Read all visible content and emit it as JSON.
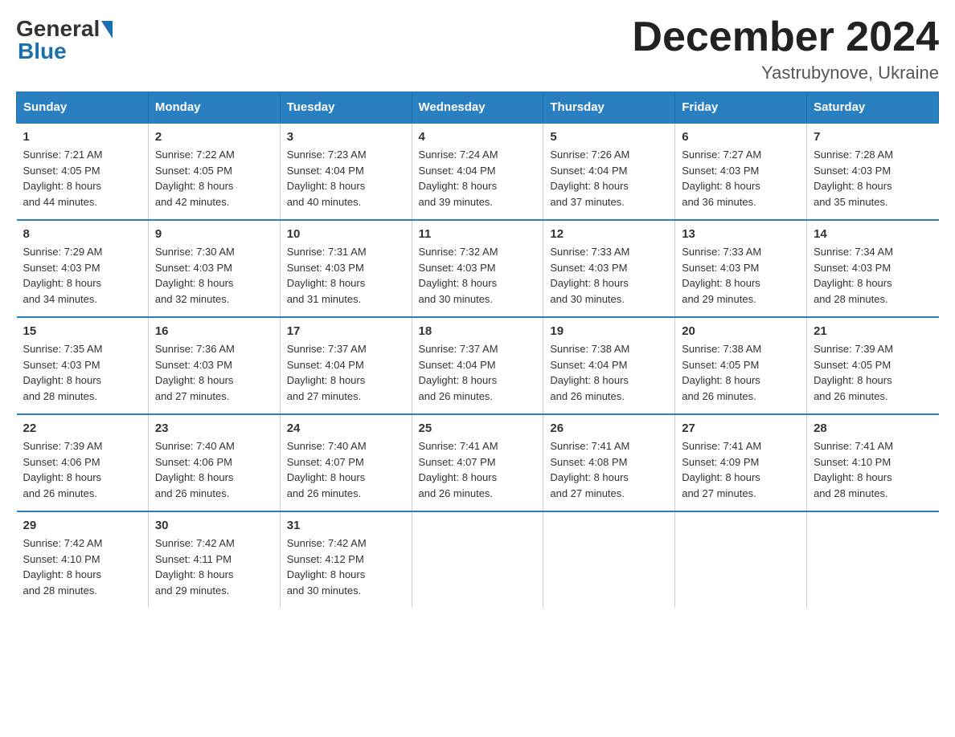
{
  "logo": {
    "general": "General",
    "blue": "Blue"
  },
  "header": {
    "month": "December 2024",
    "location": "Yastrubynove, Ukraine"
  },
  "days_of_week": [
    "Sunday",
    "Monday",
    "Tuesday",
    "Wednesday",
    "Thursday",
    "Friday",
    "Saturday"
  ],
  "weeks": [
    [
      {
        "day": "1",
        "sunrise": "7:21 AM",
        "sunset": "4:05 PM",
        "daylight": "8 hours and 44 minutes."
      },
      {
        "day": "2",
        "sunrise": "7:22 AM",
        "sunset": "4:05 PM",
        "daylight": "8 hours and 42 minutes."
      },
      {
        "day": "3",
        "sunrise": "7:23 AM",
        "sunset": "4:04 PM",
        "daylight": "8 hours and 40 minutes."
      },
      {
        "day": "4",
        "sunrise": "7:24 AM",
        "sunset": "4:04 PM",
        "daylight": "8 hours and 39 minutes."
      },
      {
        "day": "5",
        "sunrise": "7:26 AM",
        "sunset": "4:04 PM",
        "daylight": "8 hours and 37 minutes."
      },
      {
        "day": "6",
        "sunrise": "7:27 AM",
        "sunset": "4:03 PM",
        "daylight": "8 hours and 36 minutes."
      },
      {
        "day": "7",
        "sunrise": "7:28 AM",
        "sunset": "4:03 PM",
        "daylight": "8 hours and 35 minutes."
      }
    ],
    [
      {
        "day": "8",
        "sunrise": "7:29 AM",
        "sunset": "4:03 PM",
        "daylight": "8 hours and 34 minutes."
      },
      {
        "day": "9",
        "sunrise": "7:30 AM",
        "sunset": "4:03 PM",
        "daylight": "8 hours and 32 minutes."
      },
      {
        "day": "10",
        "sunrise": "7:31 AM",
        "sunset": "4:03 PM",
        "daylight": "8 hours and 31 minutes."
      },
      {
        "day": "11",
        "sunrise": "7:32 AM",
        "sunset": "4:03 PM",
        "daylight": "8 hours and 30 minutes."
      },
      {
        "day": "12",
        "sunrise": "7:33 AM",
        "sunset": "4:03 PM",
        "daylight": "8 hours and 30 minutes."
      },
      {
        "day": "13",
        "sunrise": "7:33 AM",
        "sunset": "4:03 PM",
        "daylight": "8 hours and 29 minutes."
      },
      {
        "day": "14",
        "sunrise": "7:34 AM",
        "sunset": "4:03 PM",
        "daylight": "8 hours and 28 minutes."
      }
    ],
    [
      {
        "day": "15",
        "sunrise": "7:35 AM",
        "sunset": "4:03 PM",
        "daylight": "8 hours and 28 minutes."
      },
      {
        "day": "16",
        "sunrise": "7:36 AM",
        "sunset": "4:03 PM",
        "daylight": "8 hours and 27 minutes."
      },
      {
        "day": "17",
        "sunrise": "7:37 AM",
        "sunset": "4:04 PM",
        "daylight": "8 hours and 27 minutes."
      },
      {
        "day": "18",
        "sunrise": "7:37 AM",
        "sunset": "4:04 PM",
        "daylight": "8 hours and 26 minutes."
      },
      {
        "day": "19",
        "sunrise": "7:38 AM",
        "sunset": "4:04 PM",
        "daylight": "8 hours and 26 minutes."
      },
      {
        "day": "20",
        "sunrise": "7:38 AM",
        "sunset": "4:05 PM",
        "daylight": "8 hours and 26 minutes."
      },
      {
        "day": "21",
        "sunrise": "7:39 AM",
        "sunset": "4:05 PM",
        "daylight": "8 hours and 26 minutes."
      }
    ],
    [
      {
        "day": "22",
        "sunrise": "7:39 AM",
        "sunset": "4:06 PM",
        "daylight": "8 hours and 26 minutes."
      },
      {
        "day": "23",
        "sunrise": "7:40 AM",
        "sunset": "4:06 PM",
        "daylight": "8 hours and 26 minutes."
      },
      {
        "day": "24",
        "sunrise": "7:40 AM",
        "sunset": "4:07 PM",
        "daylight": "8 hours and 26 minutes."
      },
      {
        "day": "25",
        "sunrise": "7:41 AM",
        "sunset": "4:07 PM",
        "daylight": "8 hours and 26 minutes."
      },
      {
        "day": "26",
        "sunrise": "7:41 AM",
        "sunset": "4:08 PM",
        "daylight": "8 hours and 27 minutes."
      },
      {
        "day": "27",
        "sunrise": "7:41 AM",
        "sunset": "4:09 PM",
        "daylight": "8 hours and 27 minutes."
      },
      {
        "day": "28",
        "sunrise": "7:41 AM",
        "sunset": "4:10 PM",
        "daylight": "8 hours and 28 minutes."
      }
    ],
    [
      {
        "day": "29",
        "sunrise": "7:42 AM",
        "sunset": "4:10 PM",
        "daylight": "8 hours and 28 minutes."
      },
      {
        "day": "30",
        "sunrise": "7:42 AM",
        "sunset": "4:11 PM",
        "daylight": "8 hours and 29 minutes."
      },
      {
        "day": "31",
        "sunrise": "7:42 AM",
        "sunset": "4:12 PM",
        "daylight": "8 hours and 30 minutes."
      },
      null,
      null,
      null,
      null
    ]
  ],
  "labels": {
    "sunrise": "Sunrise:",
    "sunset": "Sunset:",
    "daylight": "Daylight:"
  }
}
